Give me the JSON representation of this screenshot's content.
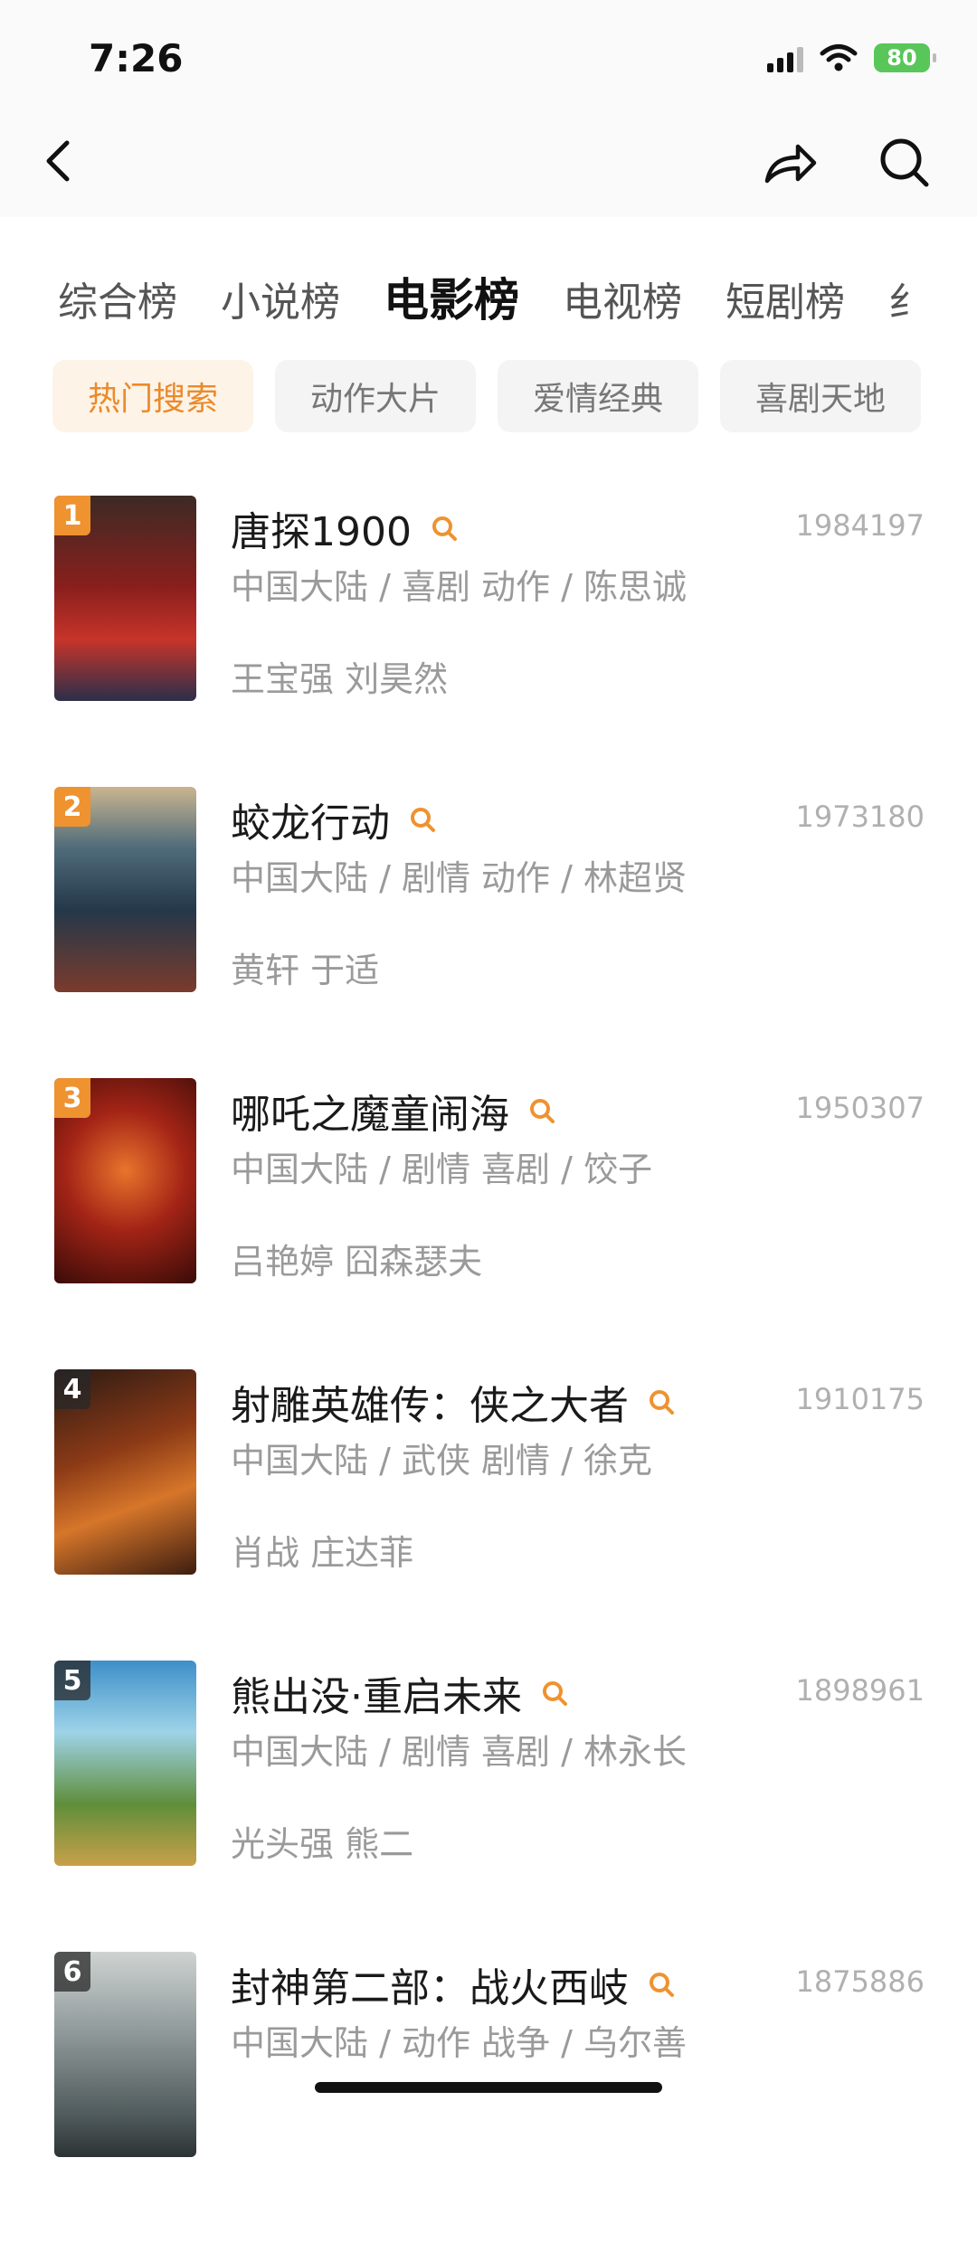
{
  "status_bar": {
    "time": "7:26",
    "battery": "80"
  },
  "tabs": [
    "综合榜",
    "小说榜",
    "电影榜",
    "电视榜",
    "短剧榜",
    "纟"
  ],
  "active_tab": 2,
  "chips": [
    "热门搜索",
    "动作大片",
    "爱情经典",
    "喜剧天地"
  ],
  "active_chip": 0,
  "movies": [
    {
      "rank": "1",
      "title": "唐探1900",
      "score": "1984197",
      "meta": "中国大陆 / 喜剧 动作 / 陈思诚",
      "cast": "王宝强 刘昊然"
    },
    {
      "rank": "2",
      "title": "蛟龙行动",
      "score": "1973180",
      "meta": "中国大陆 / 剧情 动作 / 林超贤",
      "cast": "黄轩 于适"
    },
    {
      "rank": "3",
      "title": "哪吒之魔童闹海",
      "score": "1950307",
      "meta": "中国大陆 / 剧情 喜剧 / 饺子",
      "cast": "吕艳婷 囧森瑟夫"
    },
    {
      "rank": "4",
      "title": "射雕英雄传：侠之大者",
      "score": "1910175",
      "meta": "中国大陆 / 武侠 剧情 / 徐克",
      "cast": "肖战 庄达菲"
    },
    {
      "rank": "5",
      "title": "熊出没·重启未来",
      "score": "1898961",
      "meta": "中国大陆 / 剧情 喜剧 / 林永长",
      "cast": "光头强 熊二"
    },
    {
      "rank": "6",
      "title": "封神第二部：战火西岐",
      "score": "1875886",
      "meta": "中国大陆 / 动作 战争 / 乌尔善",
      "cast": ""
    }
  ],
  "colors": {
    "accent": "#ef9230",
    "chip_active_bg": "#fdf3e7",
    "chip_active_text": "#ec8a2a"
  }
}
